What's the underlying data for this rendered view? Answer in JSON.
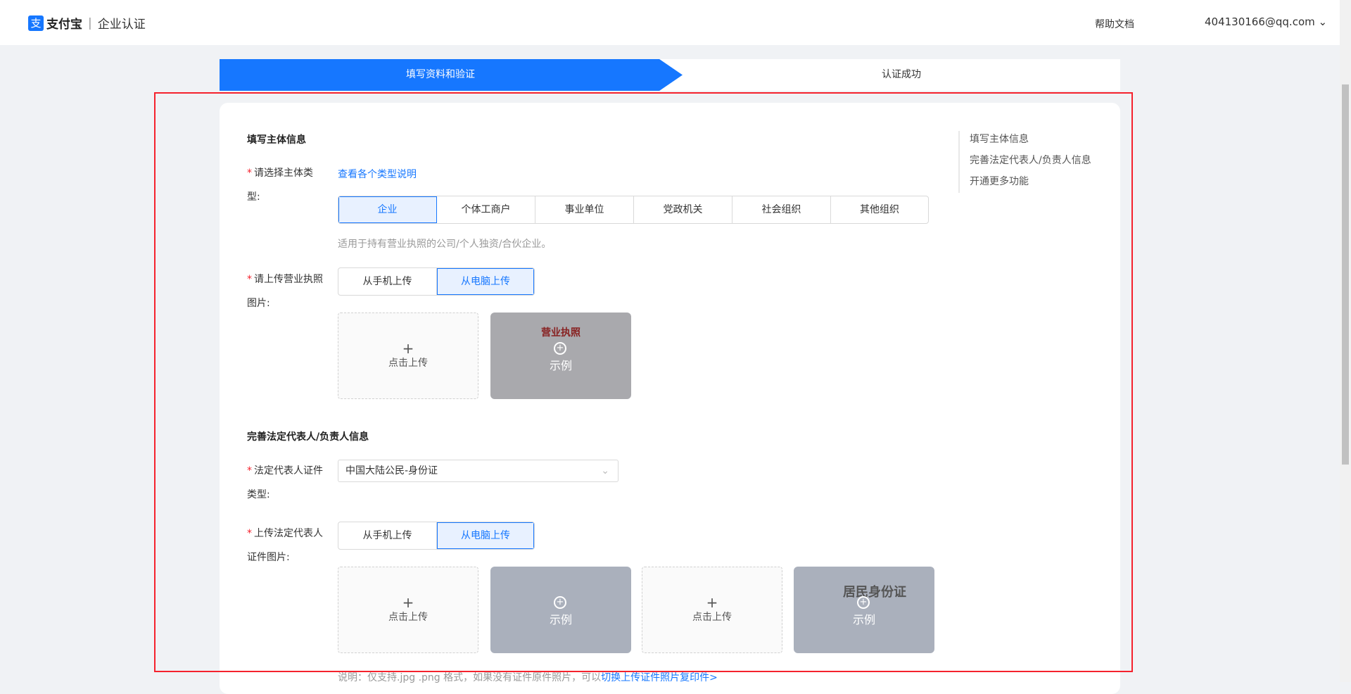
{
  "header": {
    "logo_brand": "支付宝",
    "logo_product": "企业认证",
    "help": "帮助文档",
    "account": "404130166@qq.com"
  },
  "steps": [
    "填写资料和验证",
    "认证成功"
  ],
  "section1": {
    "title": "填写主体信息",
    "type_label_1": "请选择主体类",
    "type_label_2": "型:",
    "type_link": "查看各个类型说明",
    "types": [
      "企业",
      "个体工商户",
      "事业单位",
      "党政机关",
      "社会组织",
      "其他组织"
    ],
    "selected_type": "企业",
    "type_hint": "适用于持有营业执照的公司/个人独资/合伙企业。",
    "upload_label_1": "请上传营业执照",
    "upload_label_2": "图片:",
    "upload_modes": [
      "从手机上传",
      "从电脑上传"
    ],
    "selected_mode": "从电脑上传",
    "upload_box": "点击上传",
    "sample_label": "示例",
    "sample_title": "营业执照"
  },
  "section2": {
    "title": "完善法定代表人/负责人信息",
    "id_type_label_1": "法定代表人证件",
    "id_type_label_2": "类型:",
    "id_type_value": "中国大陆公民-身份证",
    "upload_label_1": "上传法定代表人",
    "upload_label_2": "证件图片:",
    "upload_modes": [
      "从手机上传",
      "从电脑上传"
    ],
    "selected_mode": "从电脑上传",
    "upload_box": "点击上传",
    "sample_label": "示例",
    "id_back_title": "居民身份证",
    "note_prefix": "说明：仅支持.jpg .png 格式，如果没有证件原件照片，可以",
    "note_link": "切换上传证件照片复印件>"
  },
  "right_nav": [
    "填写主体信息",
    "完善法定代表人/负责人信息",
    "开通更多功能"
  ],
  "colors": {
    "primary": "#1677ff",
    "required": "#f5222d",
    "highlight_box": "#f5222d"
  }
}
